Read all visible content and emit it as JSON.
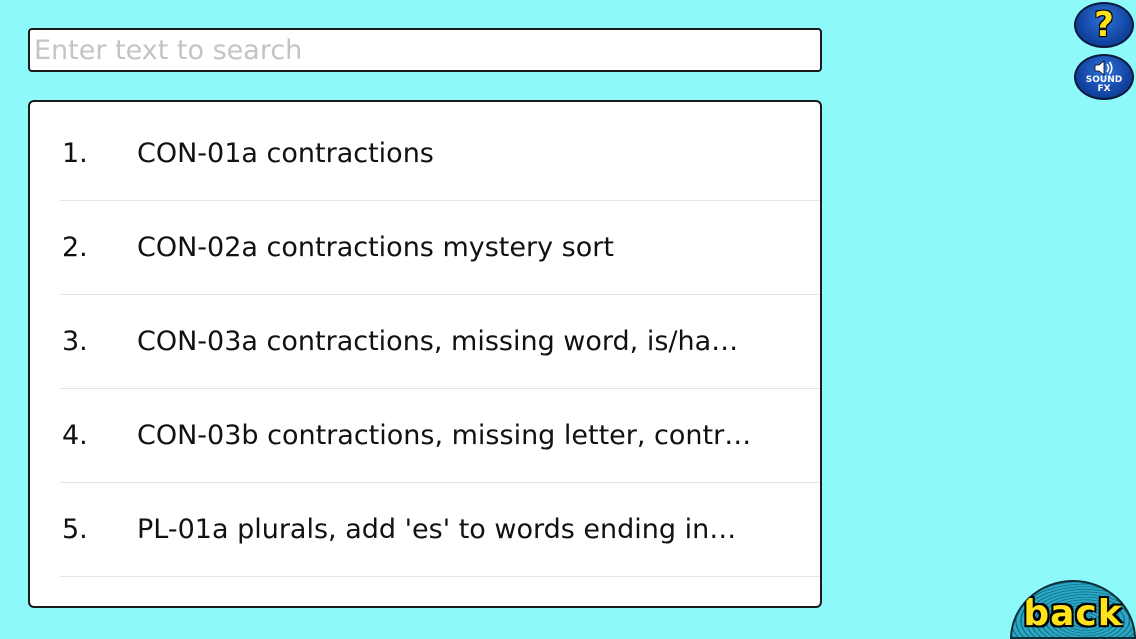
{
  "search": {
    "placeholder": "Enter text to search",
    "value": ""
  },
  "list": {
    "items": [
      {
        "number": "1.",
        "label": "CON-01a contractions"
      },
      {
        "number": "2.",
        "label": "CON-02a contractions mystery sort"
      },
      {
        "number": "3.",
        "label": "CON-03a contractions, missing word, is/ha…"
      },
      {
        "number": "4.",
        "label": "CON-03b contractions, missing letter, contr…"
      },
      {
        "number": "5.",
        "label": "PL-01a plurals, add 'es' to words ending in…"
      }
    ]
  },
  "buttons": {
    "help_label": "?",
    "sound_label_line1": "SOUND",
    "sound_label_line2": "FX",
    "back_label": "back"
  },
  "colors": {
    "background": "#8ef9fb",
    "button_blue": "#0e3f9b",
    "button_text_yellow": "#ffe21a"
  },
  "icons": {
    "help": "question-mark-icon",
    "sound": "speaker-icon"
  }
}
